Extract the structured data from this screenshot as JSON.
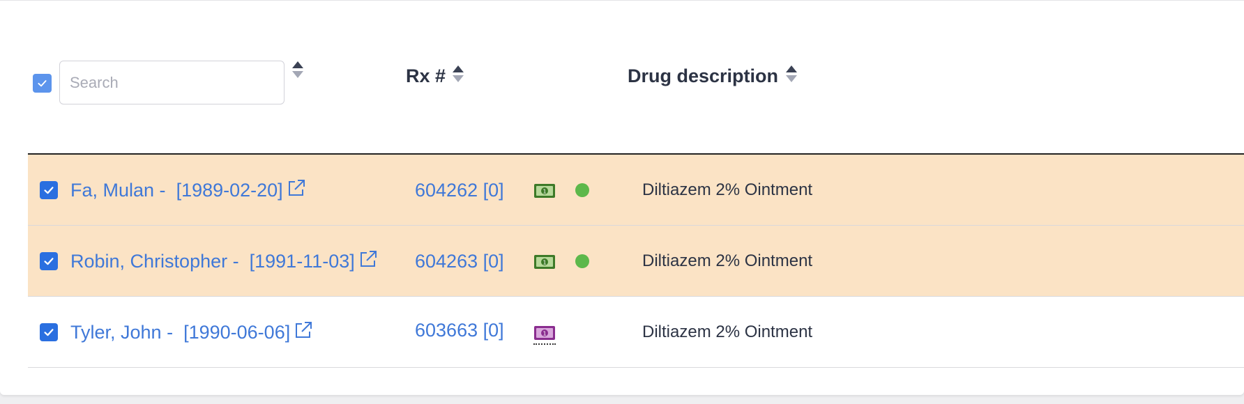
{
  "search": {
    "placeholder": "Search",
    "value": ""
  },
  "columns": {
    "rx": "Rx #",
    "drug": "Drug description"
  },
  "colors": {
    "row_highlight": "#fbe3c5",
    "link": "#3f78d8",
    "status_green": "#5db84b",
    "money_green": "#3d7a28",
    "money_purple": "#8a2d8f"
  },
  "rows": [
    {
      "selected": true,
      "highlighted": true,
      "patient_name": "Fa, Mulan -",
      "patient_dob": "[1989-02-20]",
      "rx_number": "604262 [0]",
      "payment_icon": "money-green-icon",
      "status_dot": true,
      "drug": "Diltiazem 2% Ointment"
    },
    {
      "selected": true,
      "highlighted": true,
      "patient_name": "Robin, Christopher -",
      "patient_dob": "[1991-11-03]",
      "rx_number": "604263 [0]",
      "payment_icon": "money-green-icon",
      "status_dot": true,
      "drug": "Diltiazem 2% Ointment"
    },
    {
      "selected": true,
      "highlighted": false,
      "patient_name": "Tyler, John -",
      "patient_dob": "[1990-06-06]",
      "rx_number": "603663 [0]",
      "payment_icon": "money-purple-icon",
      "status_dot": false,
      "drug": "Diltiazem 2% Ointment"
    }
  ]
}
